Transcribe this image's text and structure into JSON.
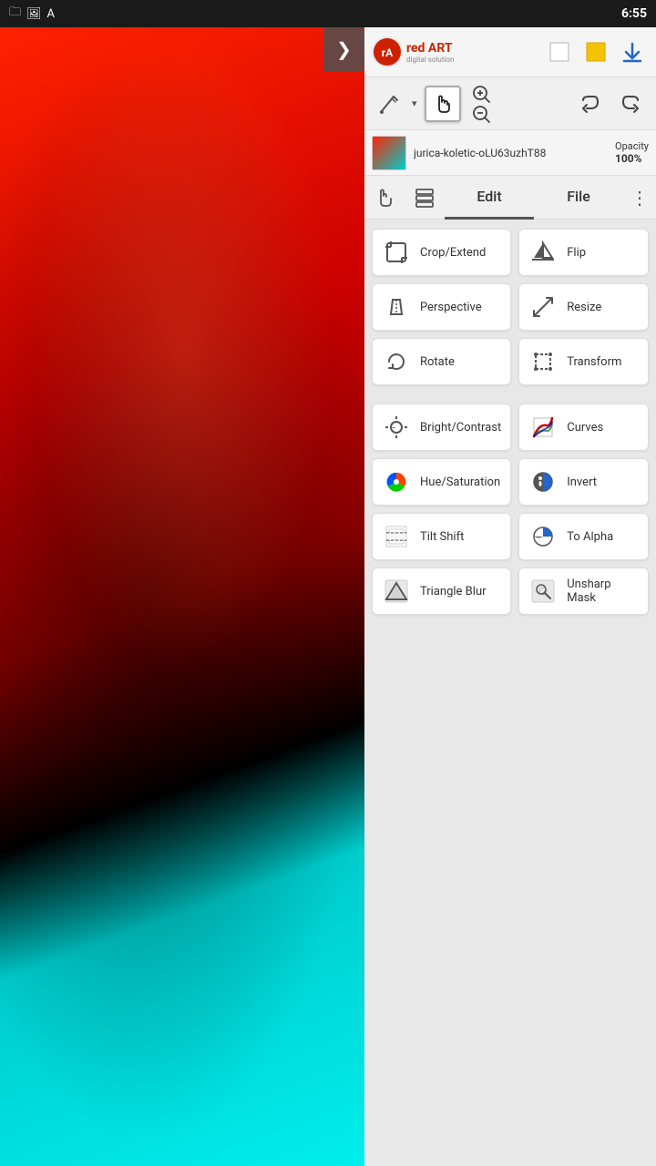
{
  "statusBar": {
    "time": "6:55",
    "icons": [
      "folder-icon",
      "image-icon",
      "font-icon"
    ]
  },
  "app": {
    "name": "red ART",
    "subtitle": "digital solution"
  },
  "toolbar": {
    "whiteSquare": "□",
    "yellowSquare": "🟨",
    "download": "⬇"
  },
  "tools": {
    "brush_dropdown": "▾",
    "hand_label": "✋",
    "zoom_in": "+",
    "zoom_out": "−",
    "undo": "↩",
    "redo": "↪"
  },
  "layer": {
    "name": "jurica-koletic-oLU63uzhT88",
    "opacity_label": "Opacity",
    "opacity_value": "100%"
  },
  "nav": {
    "hand_icon": "☰",
    "layers_icon": "⊞",
    "edit_tab": "Edit",
    "file_tab": "File",
    "more_icon": "⋮"
  },
  "editButtons": [
    {
      "id": "crop-extend",
      "label": "Crop/Extend",
      "icon": "crop"
    },
    {
      "id": "flip",
      "label": "Flip",
      "icon": "flip"
    },
    {
      "id": "perspective",
      "label": "Perspective",
      "icon": "perspective"
    },
    {
      "id": "resize",
      "label": "Resize",
      "icon": "resize"
    },
    {
      "id": "rotate",
      "label": "Rotate",
      "icon": "rotate"
    },
    {
      "id": "transform",
      "label": "Transform",
      "icon": "transform"
    },
    {
      "id": "bright-contrast",
      "label": "Bright/Contrast",
      "icon": "brightness"
    },
    {
      "id": "curves",
      "label": "Curves",
      "icon": "curves"
    },
    {
      "id": "hue-saturation",
      "label": "Hue/Saturation",
      "icon": "hue"
    },
    {
      "id": "invert",
      "label": "Invert",
      "icon": "invert"
    },
    {
      "id": "tilt-shift",
      "label": "Tilt Shift",
      "icon": "tiltshift"
    },
    {
      "id": "to-alpha",
      "label": "To Alpha",
      "icon": "toalpha"
    },
    {
      "id": "triangle-blur",
      "label": "Triangle Blur",
      "icon": "triangleblur"
    },
    {
      "id": "unsharp-mask",
      "label": "Unsharp Mask",
      "icon": "unsharpmask"
    }
  ]
}
